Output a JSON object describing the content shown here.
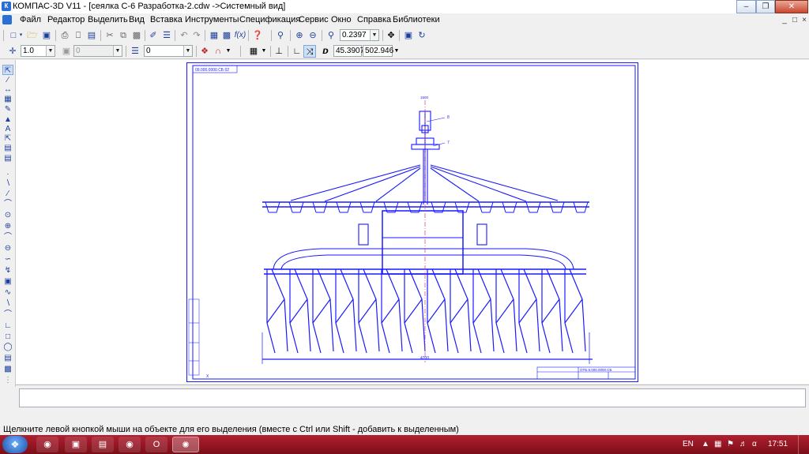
{
  "window": {
    "title": "КОМПАС-3D V11 - [сеялка С-6 Разработка-2.cdw ->Системный вид]",
    "app_icon": "kompas-app-icon",
    "controls": [
      "minimize",
      "maximize",
      "close"
    ]
  },
  "menu": {
    "items": [
      "Файл",
      "Редактор",
      "Выделить",
      "Вид",
      "Вставка",
      "Инструменты",
      "Спецификация",
      "Сервис",
      "Окно",
      "Справка",
      "Библиотеки"
    ]
  },
  "toolbar1": {
    "zoom_value": "0.2397"
  },
  "toolbar2": {
    "style_value": "1.0",
    "layer_value": "0",
    "width_value": "0",
    "coord_x": "45.3907",
    "coord_y": "502.946"
  },
  "drawing": {
    "stamp_top_left": "09.000.0000.СБ 02",
    "top_label": "1500",
    "callout_1": "8",
    "callout_2": "7",
    "dimension_label": "4200",
    "title_block_code": "ОТБ.9.000.0000.СБ",
    "corner_label": "Х"
  },
  "status": {
    "message": "Щелкните левой кнопкой мыши на объекте для его выделения (вместе с Ctrl или Shift - добавить к выделенным)"
  },
  "taskbar": {
    "language": "EN",
    "time": "17:51",
    "apps": [
      "chrome",
      "save-manager",
      "folder",
      "media",
      "opera",
      "kompas"
    ]
  },
  "colors": {
    "drawing_line": "#1a1aff",
    "axis_line": "#d04080",
    "taskbar_accent": "#9b1727"
  }
}
